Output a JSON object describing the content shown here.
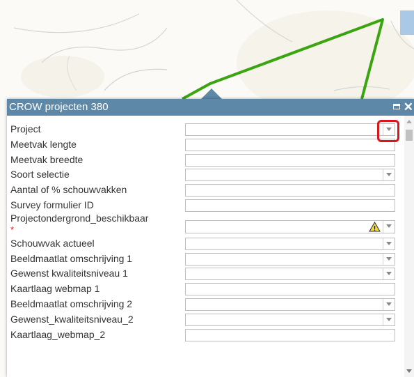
{
  "popup": {
    "title": "CROW projecten 380",
    "close_glyph": "✕",
    "icons": [
      "maximize-icon",
      "close-icon",
      "warning-icon",
      "chevron-down-icon"
    ],
    "highlight_color": "#d8161c",
    "header_color": "#5d88a8",
    "route_color": "#3aa510"
  },
  "fields": [
    {
      "label": "Project",
      "type": "dropdown",
      "value": ""
    },
    {
      "label": "Meetvak lengte",
      "type": "text",
      "value": ""
    },
    {
      "label": "Meetvak breedte",
      "type": "text",
      "value": ""
    },
    {
      "label": "Soort selectie",
      "type": "dropdown",
      "value": ""
    },
    {
      "label": "Aantal of % schouwvakken",
      "type": "text",
      "value": ""
    },
    {
      "label": "Survey formulier ID",
      "type": "text",
      "value": ""
    },
    {
      "label": "Projectondergrond_beschikbaar",
      "type": "dropdown",
      "value": "",
      "required": "*",
      "warning": "!"
    },
    {
      "label": "Schouwvak actueel",
      "type": "dropdown",
      "value": ""
    },
    {
      "label": "Beeldmaatlat omschrijving 1",
      "type": "dropdown",
      "value": ""
    },
    {
      "label": "Gewenst kwaliteitsniveau 1",
      "type": "dropdown",
      "value": ""
    },
    {
      "label": "Kaartlaag webmap 1",
      "type": "text",
      "value": ""
    },
    {
      "label": "Beeldmaatlat omschrijving 2",
      "type": "dropdown",
      "value": ""
    },
    {
      "label": "Gewenst_kwaliteitsniveau_2",
      "type": "dropdown",
      "value": ""
    },
    {
      "label": "Kaartlaag_webmap_2",
      "type": "text",
      "value": ""
    }
  ]
}
